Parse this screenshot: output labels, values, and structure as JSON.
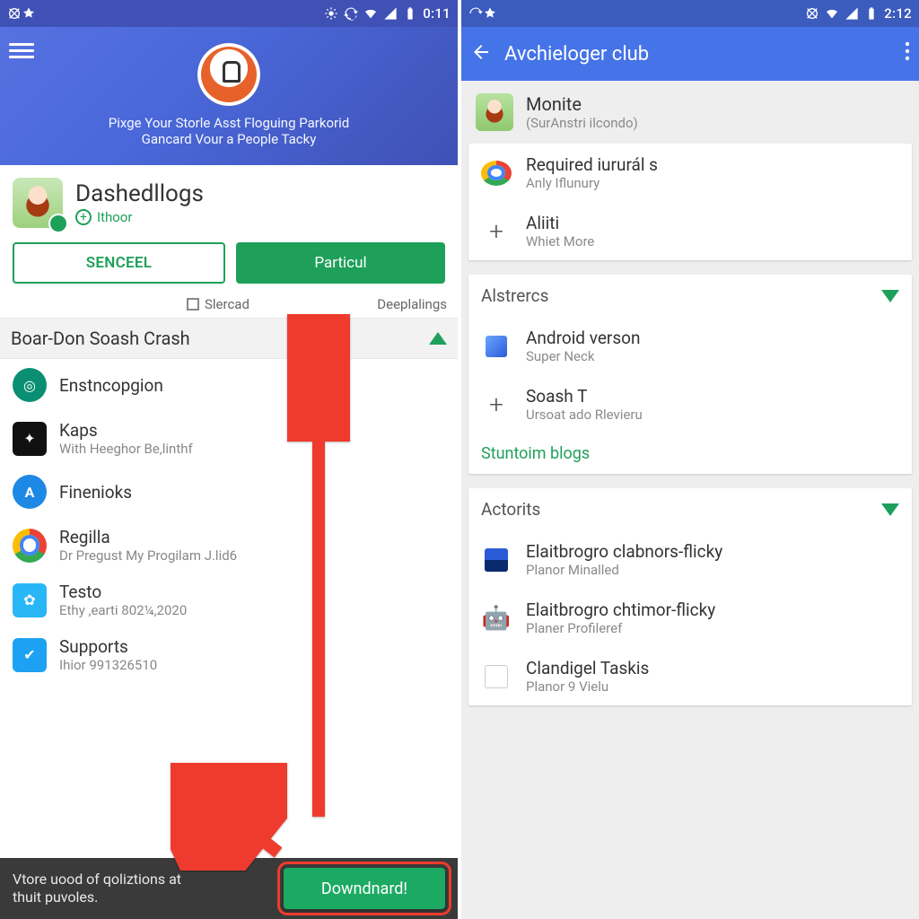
{
  "left": {
    "status": {
      "time": "0:11"
    },
    "header": {
      "tag1": "Pixge Your Storle Asst Floguing Parkorid",
      "tag2": "Gancard Vour a People Tacky"
    },
    "app": {
      "name": "Dashedllogs",
      "publisher": "Ithoor"
    },
    "buttons": {
      "cancel": "SENCEEL",
      "install": "Particul"
    },
    "tabs": {
      "center": "Slercad",
      "right": "Deeplalings"
    },
    "section": "Boar-Don Soash Crash",
    "items": [
      {
        "title": "Enstncopgion",
        "sub": "",
        "icon": "teal-gear"
      },
      {
        "title": "Kaps",
        "sub": "With Heeghor Be,linthf",
        "icon": "black-star"
      },
      {
        "title": "Finenioks",
        "sub": "",
        "icon": "blue-a"
      },
      {
        "title": "Regilla",
        "sub": "Dr Pregust My Progilam J.lid6",
        "icon": "chrome"
      },
      {
        "title": "Testo",
        "sub": "Ethy ,earti 802¼,2020",
        "icon": "cyan-gear"
      },
      {
        "title": "Supports",
        "sub": "Ihior 991326510",
        "icon": "twitter"
      }
    ],
    "toast": {
      "msg": "Vtore uood of qoliztions at\nthuit puvoles.",
      "action": "Downdnard!"
    }
  },
  "right": {
    "status": {
      "time": "2:12"
    },
    "title": "Avchieloger club",
    "user": {
      "name": "Monite",
      "sub": "(SurAnstri ilcondo)"
    },
    "links": [
      {
        "title": "Required iururál s",
        "sub": "Anly Iflunury",
        "icon": "chrome"
      },
      {
        "title": "Aliiti",
        "sub": "Whiet More",
        "icon": "plus"
      }
    ],
    "section1": "Alstrercs",
    "specs": [
      {
        "title": "Android verson",
        "sub": "Super Neck",
        "icon": "square"
      },
      {
        "title": "Soash T",
        "sub": "Ursoat ado Rlevieru",
        "icon": "plus"
      }
    ],
    "teal_link": "Stuntoim blogs",
    "section2": "Actorits",
    "apps": [
      {
        "title": "Elaitbrogro clabnors-flicky",
        "sub": "Planor Minalled",
        "icon": "blue-block"
      },
      {
        "title": "Elaitbrogro chtimor-flicky",
        "sub": "Planer Profileref",
        "icon": "android"
      },
      {
        "title": "Clandigel Taskis",
        "sub": "Planor 9 Vielu",
        "icon": "blank"
      }
    ]
  }
}
